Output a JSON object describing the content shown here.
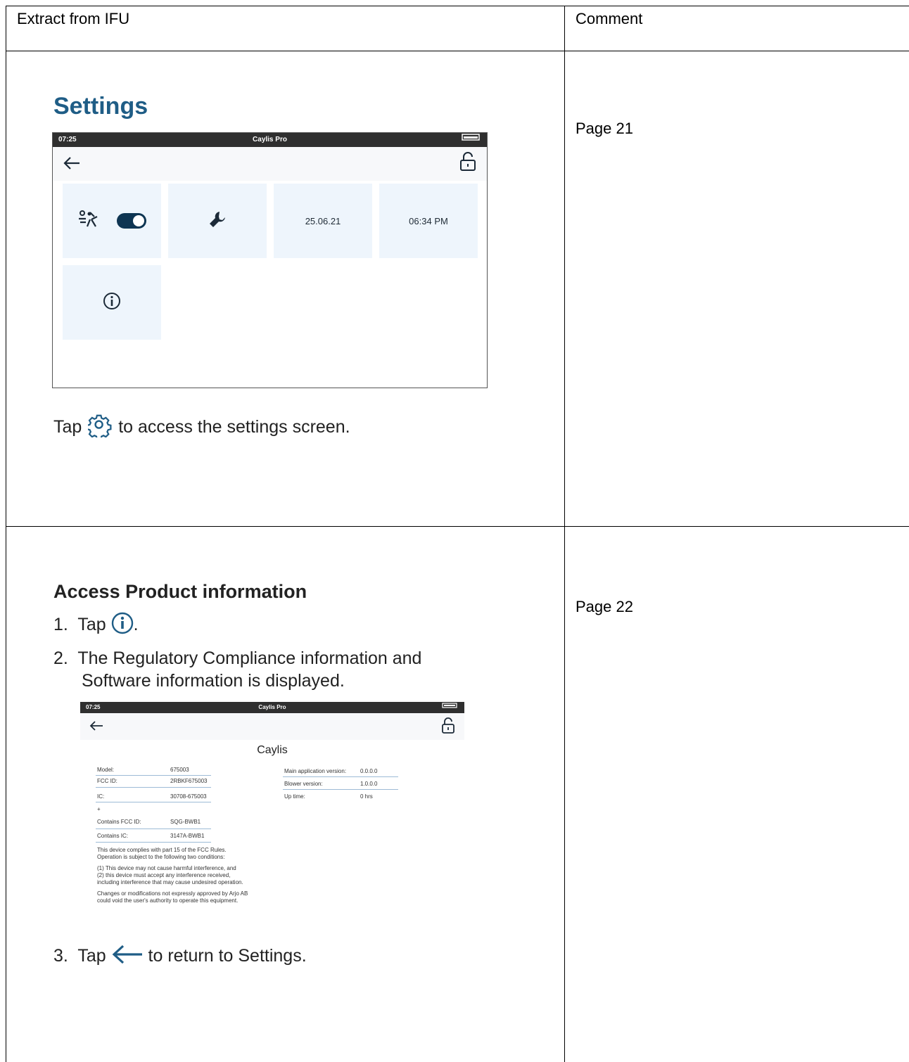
{
  "table": {
    "header_left": "Extract from IFU",
    "header_right": "Comment"
  },
  "row1": {
    "comment": "Page 21",
    "title": "Settings",
    "device": {
      "time": "07:25",
      "app_title": "Caylis Pro",
      "date_tile": "25.06.21",
      "time_tile": "06:34 PM"
    },
    "caption_before": "Tap",
    "caption_after": "to access the settings screen."
  },
  "row2": {
    "comment": "Page 22",
    "title": "Access Product information",
    "step1_num": "1.",
    "step1_text": "Tap",
    "step1_end": ".",
    "step2_num": "2.",
    "step2_line1": "The Regulatory Compliance information and",
    "step2_line2": "Software information is displayed.",
    "step3_num": "3.",
    "step3_before": "Tap",
    "step3_after": "to return to Settings.",
    "device": {
      "time": "07:25",
      "app_title": "Caylis Pro",
      "heading": "Caylis",
      "left_fields": [
        {
          "label": "Model:",
          "value": "675003"
        },
        {
          "label": "FCC ID:",
          "value": "2RBKF675003"
        },
        {
          "label": "IC:",
          "value": "30708-675003"
        }
      ],
      "plus": "+",
      "contains_fields": [
        {
          "label": "Contains FCC ID:",
          "value": "SQG-BWB1"
        },
        {
          "label": "Contains IC:",
          "value": "3147A-BWB1"
        }
      ],
      "right_fields": [
        {
          "label": "Main application version:",
          "value": "0.0.0.0"
        },
        {
          "label": "Blower version:",
          "value": "1.0.0.0"
        },
        {
          "label": "Up time:",
          "value": "0 hrs"
        }
      ],
      "fcc_para1_l1": "This device complies with part 15 of the FCC Rules.",
      "fcc_para1_l2": "Operation is subject to the following two conditions:",
      "fcc_para2_l1": "(1) This device may not cause harmful interference, and",
      "fcc_para2_l2": "(2) this device must accept any interference received,",
      "fcc_para2_l3": "including interference that may cause undesired operation.",
      "fcc_para3_l1": "Changes or modifications not expressly approved by  Arjo AB",
      "fcc_para3_l2": "could void the user's authority to operate this equipment."
    }
  }
}
